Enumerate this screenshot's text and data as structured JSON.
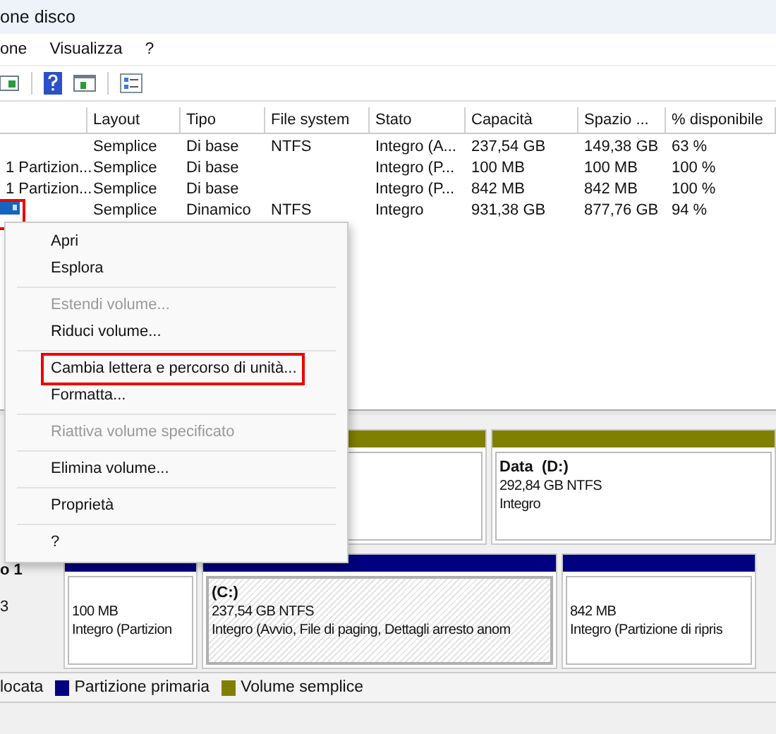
{
  "window": {
    "title": "one disco"
  },
  "menu_bar": [
    {
      "label": "one"
    },
    {
      "label": "Visualizza"
    },
    {
      "label": "?"
    }
  ],
  "table": {
    "columns": [
      "",
      "Layout",
      "Tipo",
      "File system",
      "Stato",
      "Capacità",
      "Spazio ...",
      "% disponibile"
    ],
    "rows": [
      {
        "selected": false,
        "cells": [
          "",
          "Semplice",
          "Di base",
          "NTFS",
          "Integro (A...",
          "237,54 GB",
          "149,38 GB",
          "63 %"
        ]
      },
      {
        "selected": false,
        "cells": [
          "1 Partizion...",
          "Semplice",
          "Di base",
          "",
          "Integro (P...",
          "100 MB",
          "100 MB",
          "100 %"
        ]
      },
      {
        "selected": false,
        "cells": [
          "1 Partizion...",
          "Semplice",
          "Di base",
          "",
          "Integro (P...",
          "842 MB",
          "842 MB",
          "100 %"
        ]
      },
      {
        "selected": true,
        "cells": [
          "",
          "Semplice",
          "Dinamico",
          "NTFS",
          "Integro",
          "931,38 GB",
          "877,76 GB",
          "94 %"
        ]
      }
    ]
  },
  "context_menu": [
    {
      "label": "Apri",
      "disabled": false,
      "highlighted": false,
      "separator_after": false
    },
    {
      "label": "Esplora",
      "disabled": false,
      "highlighted": false,
      "separator_after": true
    },
    {
      "label": "Estendi volume...",
      "disabled": true,
      "highlighted": false,
      "separator_after": false
    },
    {
      "label": "Riduci volume...",
      "disabled": false,
      "highlighted": false,
      "separator_after": true
    },
    {
      "label": "Cambia lettera e percorso di unità...",
      "disabled": false,
      "highlighted": true,
      "separator_after": false
    },
    {
      "label": "Formatta...",
      "disabled": false,
      "highlighted": false,
      "separator_after": true
    },
    {
      "label": "Riattiva volume specificato",
      "disabled": true,
      "highlighted": false,
      "separator_after": true
    },
    {
      "label": "Elimina volume...",
      "disabled": false,
      "highlighted": false,
      "separator_after": true
    },
    {
      "label": "Proprietà",
      "disabled": false,
      "highlighted": false,
      "separator_after": true
    },
    {
      "label": "?",
      "disabled": false,
      "highlighted": false,
      "separator_after": false
    }
  ],
  "disks": [
    {
      "partitions": [
        {
          "kind": "simple",
          "selected": false
        },
        {
          "kind": "simple",
          "selected": false,
          "name": "Data  (D:)",
          "lines": [
            "292,84 GB NTFS",
            "Integro"
          ]
        }
      ]
    },
    {
      "label": "o 1",
      "size": "3",
      "partitions": [
        {
          "kind": "primary",
          "selected": false,
          "lines": [
            "100 MB",
            "Integro (Partizion"
          ]
        },
        {
          "kind": "primary",
          "selected": true,
          "name": "(C:)",
          "lines": [
            "237,54 GB NTFS",
            "Integro (Avvio, File di paging, Dettagli arresto anom"
          ]
        },
        {
          "kind": "primary",
          "selected": false,
          "lines": [
            "842 MB",
            "Integro (Partizione di ripris"
          ]
        }
      ]
    }
  ],
  "legend": [
    {
      "label": "locata",
      "kind": "unallocated"
    },
    {
      "label": "Partizione primaria",
      "kind": "primary"
    },
    {
      "label": "Volume semplice",
      "kind": "simple"
    }
  ]
}
